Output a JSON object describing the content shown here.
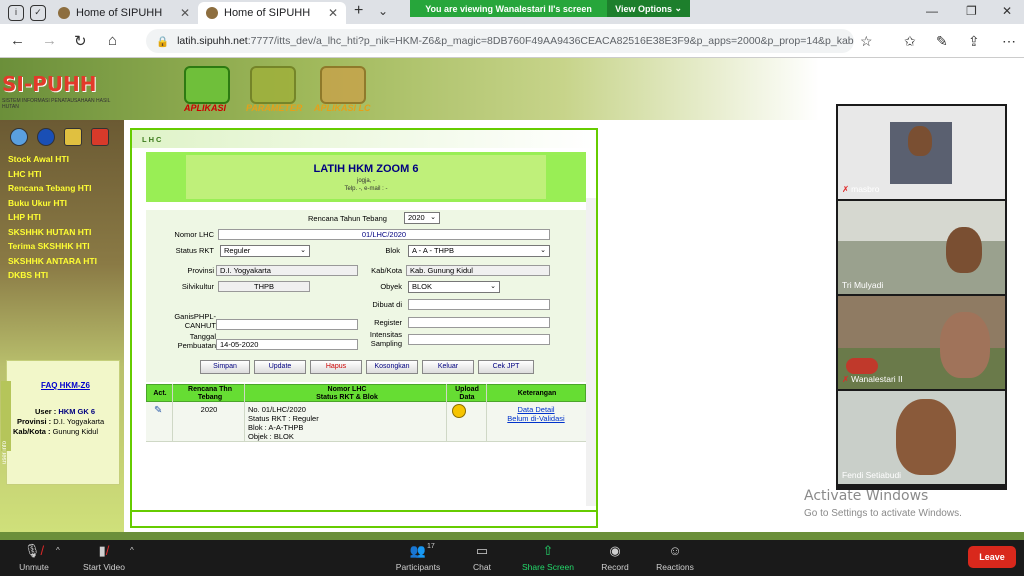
{
  "browser": {
    "tabs": [
      {
        "title": "Home of SIPUHH",
        "active": false,
        "badge": "Recording"
      },
      {
        "title": "Home of SIPUHH",
        "active": true
      }
    ],
    "url_host": "latih.sipuhh.net",
    "url_path": ":7777/itts_dev/a_lhc_hti?p_nik=HKM-Z6&p_magic=8DB760F49AA9436CEACA82516E38E3F9&p_apps=2000&p_prop=14&p_kab=03&p_s",
    "screen_share_banner": "You are viewing Wanalestari II's screen",
    "view_options": "View Options"
  },
  "site": {
    "logo": "SI-PUHH",
    "logo_subtitle": "SISTEM INFORMASI PENATAUSAHAAN HASIL HUTAN",
    "menu": [
      {
        "label": "APLIKASI",
        "color": "#cc0000"
      },
      {
        "label": "PARAMETER",
        "color": "#e5a01a"
      },
      {
        "label": "APLIKASI LC",
        "color": "#e5a01a"
      }
    ]
  },
  "sidebar": {
    "links": [
      "Stock Awal HTI",
      "LHC HTI",
      "Rencana Tebang HTI",
      "Buku Ukur HTI",
      "LHP HTI",
      "SKSHHK HUTAN HTI",
      "Terima SKSHHK HTI",
      "SKSHHK ANTARA HTI",
      "DKBS HTI"
    ],
    "side_tab": "user info",
    "faq": "FAQ HKM-Z6",
    "user_label": "User :",
    "user_value": "HKM GK 6",
    "provinsi_label": "Provinsi :",
    "provinsi_value": "D.I. Yogyakarta",
    "kabkota_label": "Kab/Kota :",
    "kabkota_value": "Gunung Kidul"
  },
  "panel": {
    "header": "LHC",
    "title": "LATIH HKM ZOOM 6",
    "subtitle1": "jogja, -",
    "subtitle2": "Telp. -, e-mail : -"
  },
  "form": {
    "rencana_label": "Rencana Tahun Tebang",
    "rencana_value": "2020",
    "nomor_label": "Nomor LHC",
    "nomor_value": "01/LHC/2020",
    "status_label": "Status RKT",
    "status_value": "Reguler",
    "blok_label": "Blok",
    "blok_value": "A - A - THPB",
    "provinsi_label": "Provinsi",
    "provinsi_value": "D.I. Yogyakarta",
    "kab_label": "Kab/Kota",
    "kab_value": "Kab. Gunung Kidul",
    "silvi_label": "Silvikultur",
    "silvi_value": "THPB",
    "obyek_label": "Obyek",
    "obyek_value": "BLOK",
    "dibuat_label": "Dibuat di",
    "dibuat_value": "",
    "ganis_label1": "GanisPHPL-",
    "ganis_label2": "CANHUT",
    "ganis_value": "",
    "register_label": "Register",
    "register_value": "",
    "tgl_label1": "Tanggal",
    "tgl_label2": "Pembuatan",
    "tgl_value": "14-05-2020",
    "intensitas_label1": "Intensitas",
    "intensitas_label2": "Sampling",
    "intensitas_value": "",
    "buttons": [
      "Simpan",
      "Update",
      "Hapus",
      "Kosongkan",
      "Keluar",
      "Cek JPT"
    ]
  },
  "table": {
    "headers": {
      "act": "Act.",
      "rencana1": "Rencana Thn",
      "rencana2": "Tebang",
      "nomor1": "Nomor LHC",
      "nomor2": "Status RKT & Blok",
      "upload1": "Upload",
      "upload2": "Data",
      "ket": "Keterangan"
    },
    "rows": [
      {
        "tahun": "2020",
        "no": "No. 01/LHC/2020",
        "status": "Status RKT : Reguler",
        "blok": "Blok : A-A-THPB",
        "objek": "Objek : BLOK",
        "link1": "Data Detail",
        "link2": "Belum di-Validasi"
      }
    ]
  },
  "windows_notice": {
    "line1": "Activate Windows",
    "line2": "Go to Settings to activate Windows."
  },
  "participants_video": [
    {
      "name": "masbro",
      "muted": true,
      "bg": "#e8e8e8"
    },
    {
      "name": "Tri Mulyadi",
      "muted": false,
      "bg": "#9aa18e"
    },
    {
      "name": "Wanalestari II",
      "muted": true,
      "bg": "#8f7b63"
    },
    {
      "name": "Fendi Setiabudi",
      "muted": false,
      "bg": "#c9cfc9"
    }
  ],
  "zoom_toolbar": {
    "unmute": "Unmute",
    "start_video": "Start Video",
    "participants": "Participants",
    "participants_count": "17",
    "chat": "Chat",
    "share_screen": "Share Screen",
    "record": "Record",
    "reactions": "Reactions",
    "leave": "Leave"
  }
}
